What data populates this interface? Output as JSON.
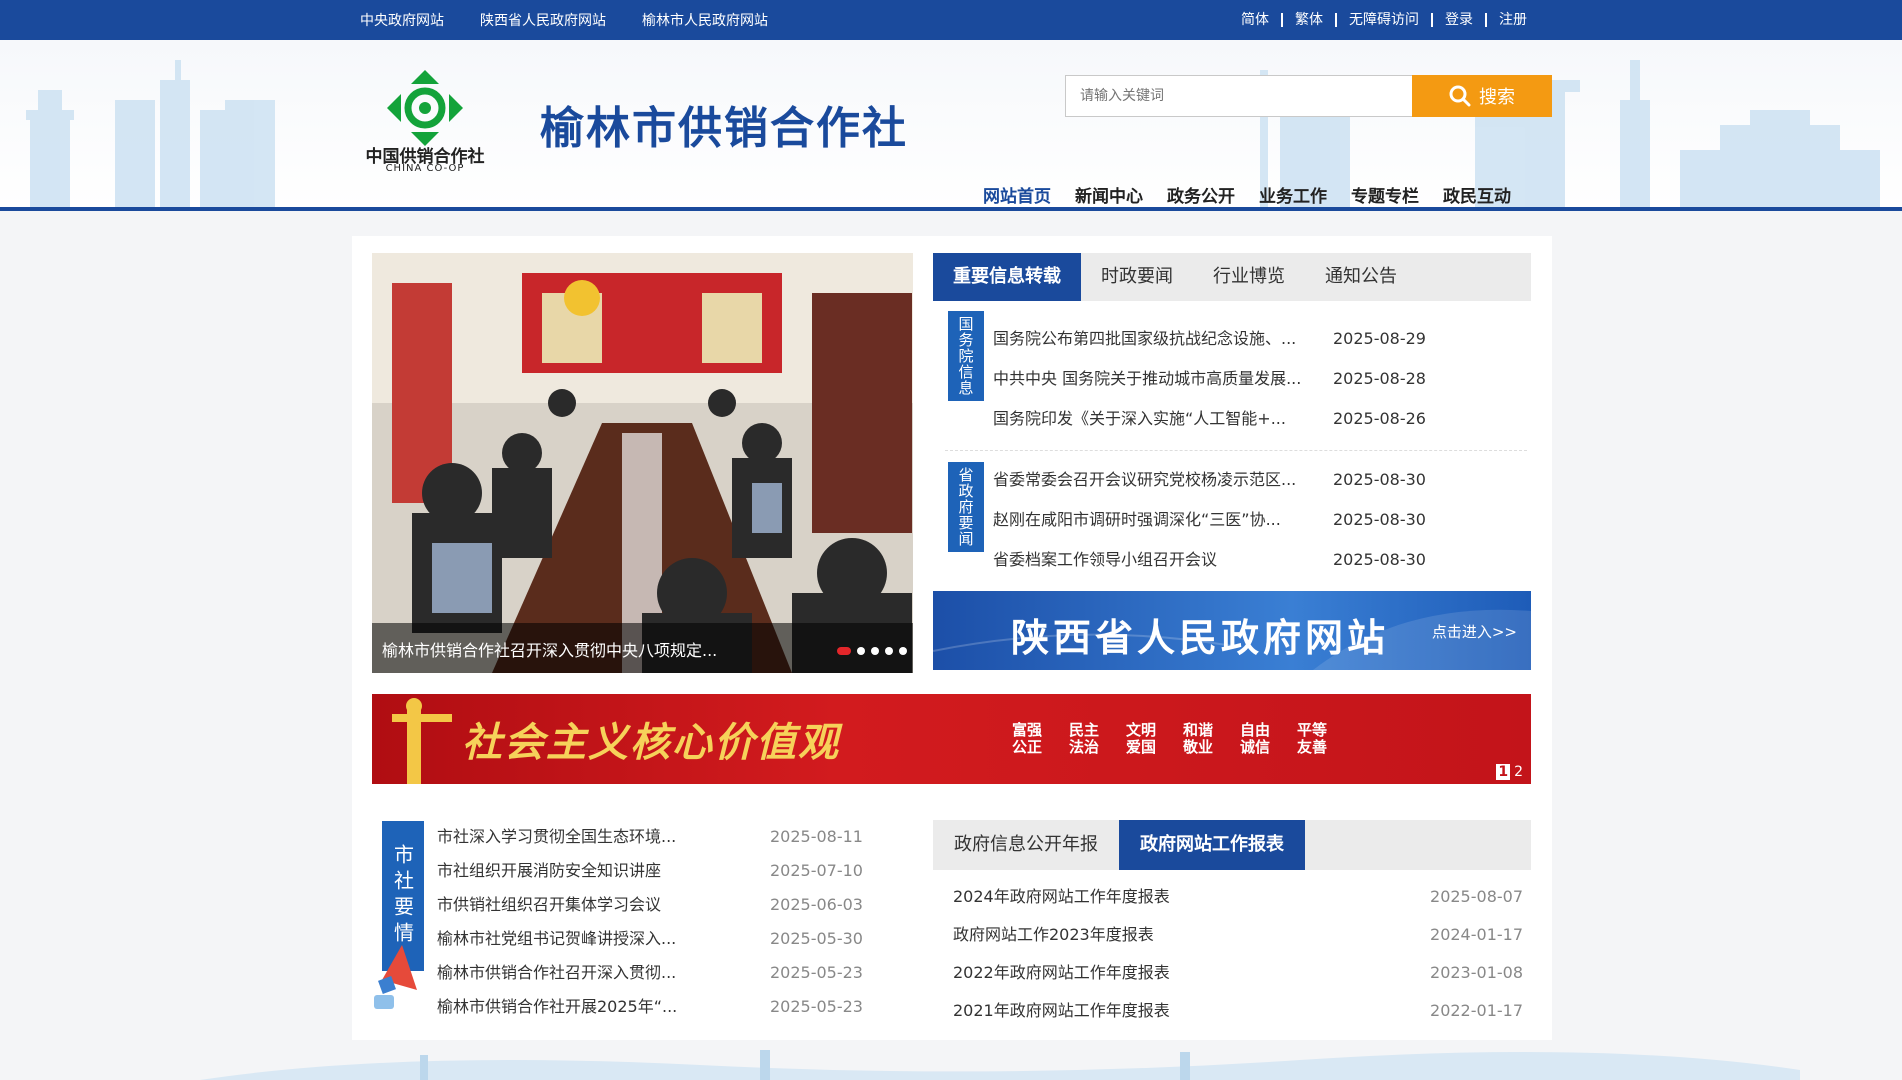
{
  "topbar": {
    "left_links": [
      "中央政府网站",
      "陕西省人民政府网站",
      "榆林市人民政府网站"
    ],
    "right_links": [
      "简体",
      "繁体",
      "无障碍访问",
      "登录",
      "注册"
    ]
  },
  "header": {
    "logo_text": "中国供销合作社",
    "logo_sub": "CHINA CO-OP",
    "site_title": "榆林市供销合作社",
    "search_placeholder": "请输入关键词",
    "search_button": "搜索",
    "nav": [
      "网站首页",
      "新闻中心",
      "政务公开",
      "业务工作",
      "专题专栏",
      "政民互动"
    ]
  },
  "slider": {
    "caption": "榆林市供销合作社召开深入贯彻中央八项规定..."
  },
  "important": {
    "tabs": [
      "重要信息转载",
      "时政要闻",
      "行业博览",
      "通知公告"
    ],
    "groups": [
      {
        "label": "国务院信息",
        "items": [
          {
            "title": "国务院公布第四批国家级抗战纪念设施、...",
            "date": "2025-08-29"
          },
          {
            "title": "中共中央 国务院关于推动城市高质量发展...",
            "date": "2025-08-28"
          },
          {
            "title": "国务院印发《关于深入实施“人工智能+...",
            "date": "2025-08-26"
          }
        ]
      },
      {
        "label": "省政府要闻",
        "items": [
          {
            "title": "省委常委会召开会议研究党校杨凌示范区...",
            "date": "2025-08-30"
          },
          {
            "title": "赵刚在咸阳市调研时强调深化“三医”协...",
            "date": "2025-08-30"
          },
          {
            "title": "省委档案工作领导小组召开会议",
            "date": "2025-08-30"
          }
        ]
      }
    ]
  },
  "gov_banner": {
    "title": "陕西省人民政府网站",
    "enter": "点击进入>>"
  },
  "core_banner": {
    "slogan": "社会主义核心价值观",
    "values": [
      "富强",
      "民主",
      "文明",
      "和谐",
      "自由",
      "平等",
      "公正",
      "法治",
      "爱国",
      "敬业",
      "诚信",
      "友善"
    ],
    "pager": [
      "1",
      "2"
    ]
  },
  "local_news": {
    "label": "市社要情",
    "items": [
      {
        "title": "市社深入学习贯彻全国生态环境...",
        "date": "2025-08-11"
      },
      {
        "title": "市社组织开展消防安全知识讲座",
        "date": "2025-07-10"
      },
      {
        "title": "市供销社组织召开集体学习会议",
        "date": "2025-06-03"
      },
      {
        "title": "榆林市社党组书记贺峰讲授深入...",
        "date": "2025-05-30"
      },
      {
        "title": "榆林市供销合作社召开深入贯彻...",
        "date": "2025-05-23"
      },
      {
        "title": "榆林市供销合作社开展2025年“...",
        "date": "2025-05-23"
      }
    ]
  },
  "reports": {
    "tabs": [
      "政府信息公开年报",
      "政府网站工作报表"
    ],
    "items": [
      {
        "title": "2024年政府网站工作年度报表",
        "date": "2025-08-07"
      },
      {
        "title": "政府网站工作2023年度报表",
        "date": "2024-01-17"
      },
      {
        "title": "2022年政府网站工作年度报表",
        "date": "2023-01-08"
      },
      {
        "title": "2021年政府网站工作年度报表",
        "date": "2022-01-17"
      }
    ]
  },
  "colors": {
    "primary": "#1a4a9c",
    "accent": "#f49a12",
    "banner_red": "#c3141a"
  }
}
